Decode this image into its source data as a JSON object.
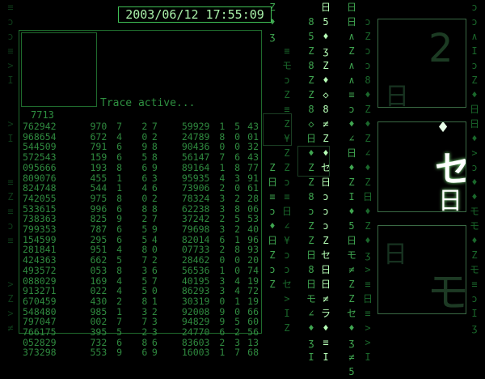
{
  "clock": "2003/06/12 17:55:09",
  "trace_label": "Trace active...",
  "trace_id": "7713",
  "table_rows": [
    [
      "762942",
      "970",
      "7",
      "2",
      "7",
      "59929",
      "1",
      "5",
      "43"
    ],
    [
      "968654",
      "672",
      "4",
      "0",
      "2",
      "24789",
      "8",
      "0",
      "01"
    ],
    [
      "544509",
      "791",
      "6",
      "9",
      "8",
      "90436",
      "0",
      "0",
      "32"
    ],
    [
      "572543",
      "159",
      "6",
      "5",
      "8",
      "56147",
      "7",
      "6",
      "43"
    ],
    [
      "095666",
      "193",
      "8",
      "6",
      "9",
      "89164",
      "1",
      "8",
      "77"
    ],
    [
      "809076",
      "455",
      "1",
      "6",
      "3",
      "95935",
      "4",
      "3",
      "91"
    ],
    [
      "824748",
      "544",
      "1",
      "4",
      "6",
      "73906",
      "2",
      "0",
      "61"
    ],
    [
      "742055",
      "975",
      "8",
      "0",
      "2",
      "78324",
      "3",
      "2",
      "28"
    ],
    [
      "533615",
      "996",
      "6",
      "8",
      "8",
      "62238",
      "3",
      "8",
      "06"
    ],
    [
      "738363",
      "825",
      "9",
      "2",
      "7",
      "37242",
      "2",
      "5",
      "53"
    ],
    [
      "799353",
      "787",
      "6",
      "5",
      "9",
      "79698",
      "3",
      "2",
      "40"
    ],
    [
      "154599",
      "295",
      "6",
      "5",
      "4",
      "82014",
      "6",
      "1",
      "96"
    ],
    [
      "281841",
      "951",
      "4",
      "8",
      "0",
      "07733",
      "2",
      "8",
      "93"
    ],
    [
      "424363",
      "662",
      "5",
      "7",
      "2",
      "28462",
      "0",
      "0",
      "20"
    ],
    [
      "493572",
      "053",
      "8",
      "3",
      "6",
      "56536",
      "1",
      "0",
      "74"
    ],
    [
      "088029",
      "169",
      "4",
      "5",
      "7",
      "40195",
      "3",
      "4",
      "19"
    ],
    [
      "913271",
      "022",
      "4",
      "5",
      "0",
      "86293",
      "3",
      "4",
      "72"
    ],
    [
      "670459",
      "430",
      "2",
      "8",
      "1",
      "30319",
      "0",
      "1",
      "19"
    ],
    [
      "548480",
      "985",
      "1",
      "3",
      "2",
      "92008",
      "9",
      "0",
      "66"
    ],
    [
      "797047",
      "002",
      "7",
      "7",
      "3",
      "94829",
      "9",
      "5",
      "60"
    ],
    [
      "766175",
      "395",
      "5",
      "2",
      "3",
      "24770",
      "6",
      "2",
      "56"
    ],
    [
      "052829",
      "732",
      "6",
      "8",
      "6",
      "83603",
      "2",
      "3",
      "13"
    ],
    [
      "373298",
      "553",
      "9",
      "6",
      "9",
      "16003",
      "1",
      "7",
      "68"
    ]
  ],
  "camera_glyphs": {
    "top": "2",
    "middle_main": "セ",
    "middle_second": "日",
    "bottom": "モ"
  },
  "rain_columns": [
    "≡≠♦日ヨ≠⊏⊐ɔ>I",
    "ɔ>ɔ∠◇モ8ラ¥Zモ",
    "∠Z♦セ↑二Z日≡Z",
    "Iモ二8>≡◇日◇",
    "日ラ8◇≠Z♦日ɔ",
    "5モ∠≠Zセ♦ʒ≠◇",
    "セZ日♦∠モ¥I5",
    "ZɔモZ8日5ラ◇",
    "◇日Z≠ɔ5♦モ∠"
  ]
}
